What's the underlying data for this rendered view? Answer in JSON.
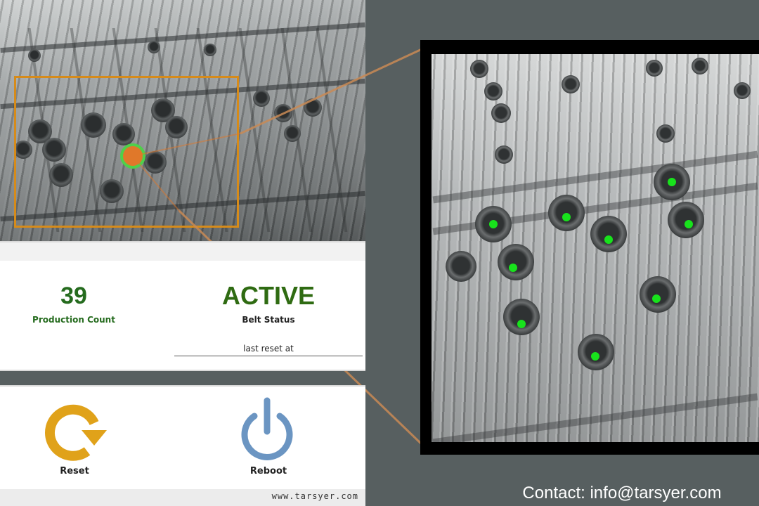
{
  "stats": {
    "production_count": "39",
    "production_count_label": "Production Count",
    "belt_status": "ACTIVE",
    "belt_status_label": "Belt Status",
    "last_reset_label": "last reset at"
  },
  "controls": {
    "reset_label": "Reset",
    "reboot_label": "Reboot"
  },
  "footer": {
    "website": "www.tarsyer.com"
  },
  "contact": {
    "text": "Contact: info@tarsyer.com"
  },
  "icons": {
    "reset": "reset-icon",
    "reboot": "power-icon"
  },
  "colors": {
    "count_green": "#256b1e",
    "bbox_orange": "#d68b1a",
    "reset_orange": "#e0a21a",
    "reboot_blue": "#6b95c2",
    "detection_green": "#18e21c"
  }
}
